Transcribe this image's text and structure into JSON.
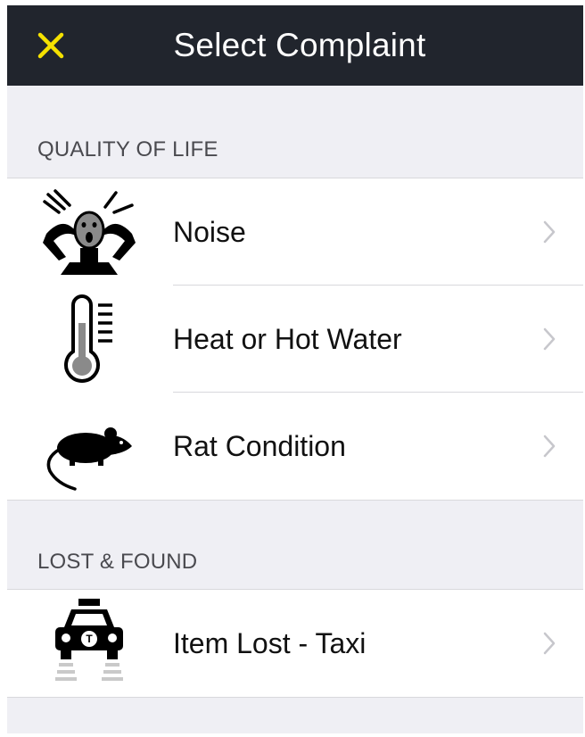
{
  "header": {
    "title": "Select Complaint",
    "close_icon": "close-x-icon",
    "close_color": "#f5e100"
  },
  "sections": [
    {
      "title": "QUALITY OF LIFE",
      "items": [
        {
          "label": "Noise",
          "icon": "noise-icon"
        },
        {
          "label": "Heat or Hot Water",
          "icon": "thermometer-icon"
        },
        {
          "label": "Rat Condition",
          "icon": "rat-icon"
        }
      ]
    },
    {
      "title": "LOST & FOUND",
      "items": [
        {
          "label": "Item Lost - Taxi",
          "icon": "taxi-icon"
        }
      ]
    }
  ],
  "colors": {
    "navbar": "#21252d",
    "background": "#efeff4",
    "accent": "#f5e100"
  }
}
